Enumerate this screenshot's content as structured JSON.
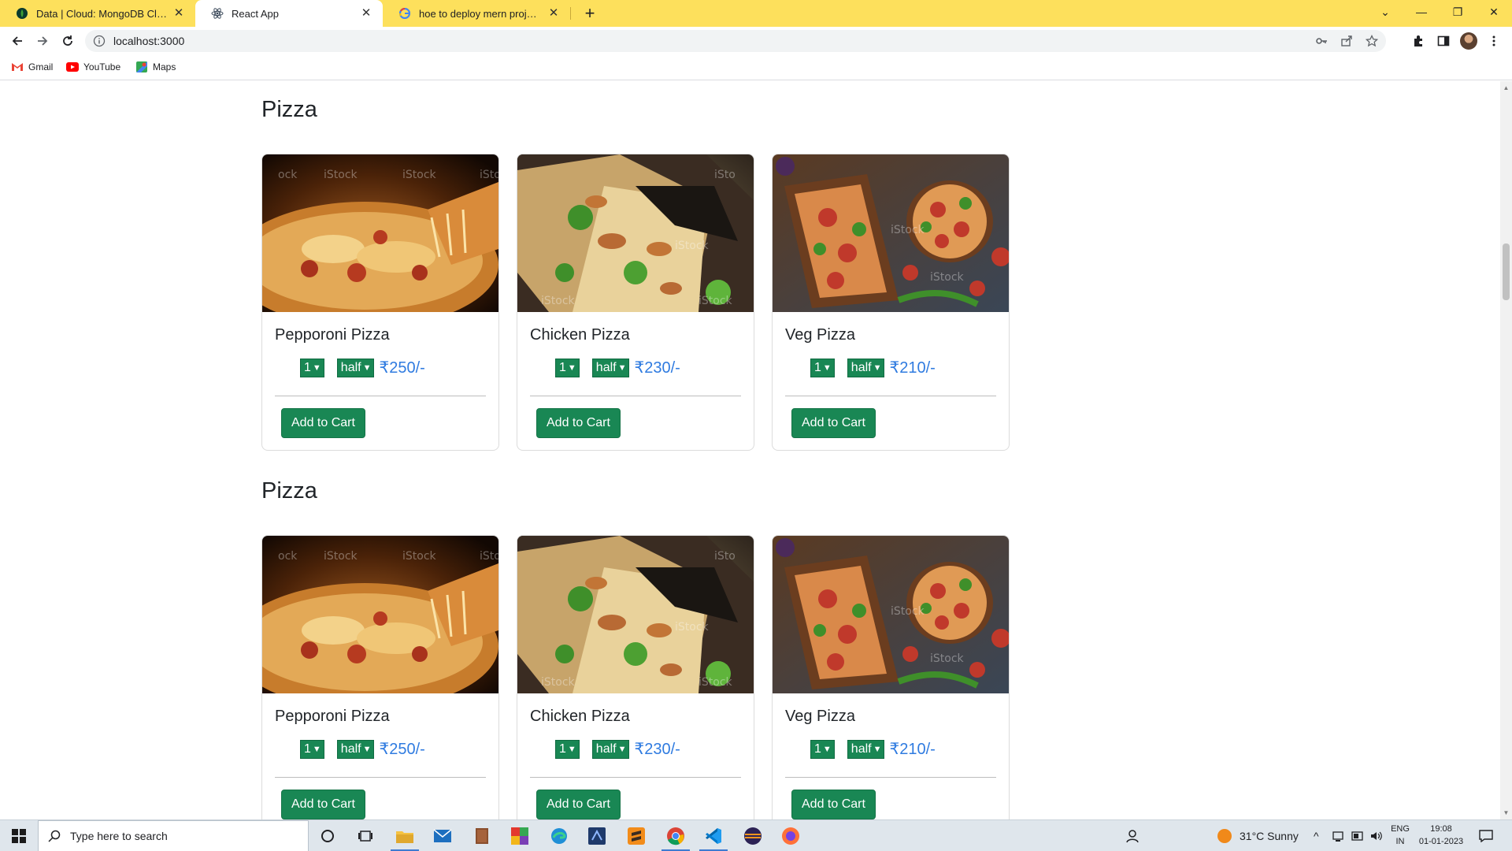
{
  "browser": {
    "tabs": [
      {
        "title": "Data | Cloud: MongoDB Cloud",
        "favicon": "mongodb-leaf-icon",
        "active": false
      },
      {
        "title": "React App",
        "favicon": "react-icon",
        "active": true
      },
      {
        "title": "hoe to deploy mern project free",
        "favicon": "google-icon",
        "active": false
      }
    ],
    "url": "localhost:3000",
    "bookmarks": [
      {
        "label": "Gmail",
        "icon": "gmail-icon"
      },
      {
        "label": "YouTube",
        "icon": "youtube-icon"
      },
      {
        "label": "Maps",
        "icon": "maps-icon"
      }
    ],
    "tab_strip_color": "#fde05c"
  },
  "page": {
    "accent": "#198754",
    "price_color": "#2f7be0",
    "sections": [
      {
        "title": "Pizza",
        "items": [
          {
            "name": "Pepporoni Pizza",
            "qty": "1",
            "size": "half",
            "price": "₹250/-",
            "button": "Add to Cart"
          },
          {
            "name": "Chicken Pizza",
            "qty": "1",
            "size": "half",
            "price": "₹230/-",
            "button": "Add to Cart"
          },
          {
            "name": "Veg Pizza",
            "qty": "1",
            "size": "half",
            "price": "₹210/-",
            "button": "Add to Cart"
          }
        ]
      },
      {
        "title": "Pizza",
        "items": [
          {
            "name": "Pepporoni Pizza",
            "qty": "1",
            "size": "half",
            "price": "₹250/-",
            "button": "Add to Cart"
          },
          {
            "name": "Chicken Pizza",
            "qty": "1",
            "size": "half",
            "price": "₹230/-",
            "button": "Add to Cart"
          },
          {
            "name": "Veg Pizza",
            "qty": "1",
            "size": "half",
            "price": "₹210/-",
            "button": "Add to Cart"
          }
        ]
      }
    ]
  },
  "taskbar": {
    "search_placeholder": "Type here to search",
    "weather": "31°C  Sunny",
    "lang_top": "ENG",
    "lang_bottom": "IN",
    "time": "19:08",
    "date": "01-01-2023"
  }
}
